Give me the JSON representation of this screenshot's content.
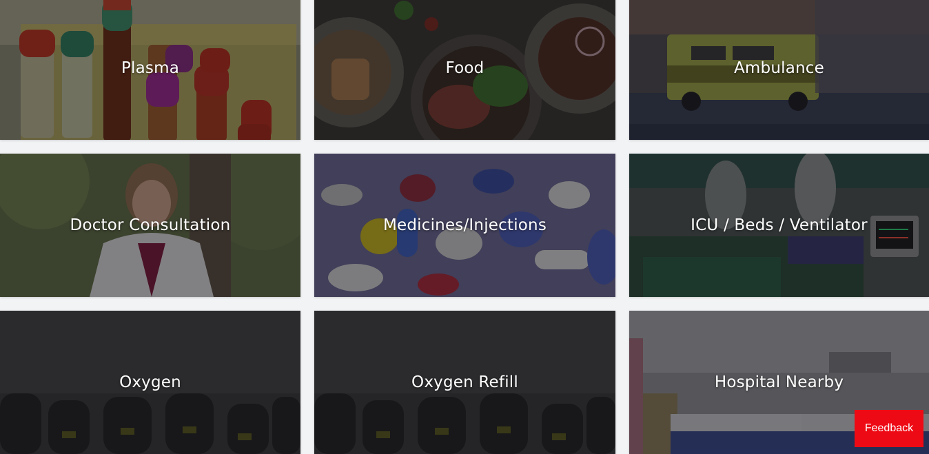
{
  "services": [
    {
      "label": "Plasma",
      "image": "plasma-test-tubes"
    },
    {
      "label": "Food",
      "image": "food-plates"
    },
    {
      "label": "Ambulance",
      "image": "ambulance-on-street"
    },
    {
      "label": "Doctor Consultation",
      "image": "doctor-portrait"
    },
    {
      "label": "Medicines/Injections",
      "image": "pills-and-capsules"
    },
    {
      "label": "ICU / Beds / Ventilator",
      "image": "icu-patient-ward"
    },
    {
      "label": "Oxygen",
      "image": "oxygen-cylinders"
    },
    {
      "label": "Oxygen Refill",
      "image": "oxygen-cylinders"
    },
    {
      "label": "Hospital Nearby",
      "image": "hospital-beds-room"
    }
  ],
  "feedback": {
    "label": "Feedback"
  },
  "colors": {
    "page_background": "#f2f3f5",
    "feedback_button": "#ee0a14",
    "card_text": "#ffffff"
  }
}
